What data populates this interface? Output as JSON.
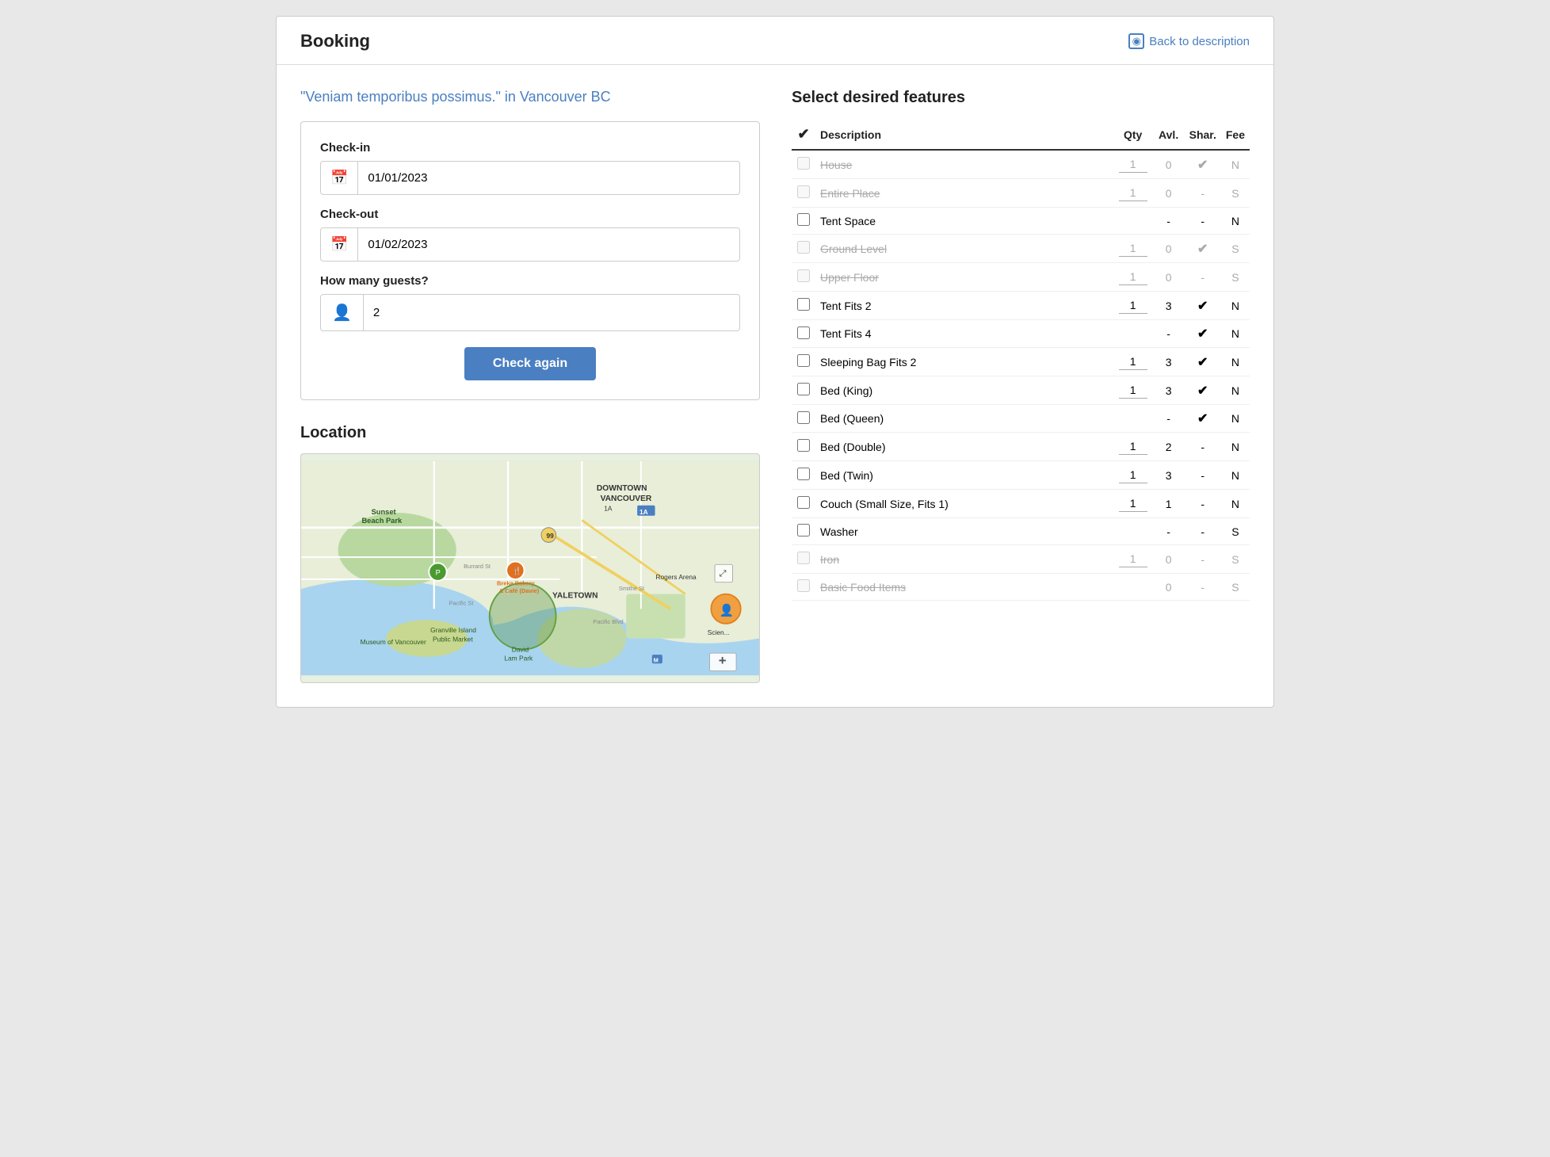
{
  "header": {
    "title": "Booking",
    "back_label": "Back to description",
    "back_icon": "◉"
  },
  "left": {
    "property_title": "\"Veniam temporibus possimus.\" in Vancouver BC",
    "checkin_label": "Check-in",
    "checkin_value": "01/01/2023",
    "checkin_placeholder": "01/01/2023",
    "checkout_label": "Check-out",
    "checkout_value": "01/02/2023",
    "checkout_placeholder": "01/02/2023",
    "guests_label": "How many guests?",
    "guests_value": "2",
    "check_again_label": "Check again",
    "location_label": "Location"
  },
  "features": {
    "title": "Select desired features",
    "columns": [
      "✔",
      "Description",
      "Qty",
      "Avl.",
      "Shar.",
      "Fee"
    ],
    "rows": [
      {
        "id": "house",
        "label": "House",
        "disabled": true,
        "strikethrough": true,
        "qty": "1",
        "avl": "0",
        "shar": "✔",
        "fee": "N",
        "checked": false
      },
      {
        "id": "entire-place",
        "label": "Entire Place",
        "disabled": true,
        "strikethrough": true,
        "qty": "1",
        "avl": "0",
        "shar": "",
        "fee": "S",
        "checked": false
      },
      {
        "id": "tent-space",
        "label": "Tent Space",
        "disabled": false,
        "strikethrough": false,
        "qty": "",
        "avl": "-",
        "shar": "",
        "fee": "N",
        "checked": false
      },
      {
        "id": "ground-level",
        "label": "Ground Level",
        "disabled": true,
        "strikethrough": true,
        "qty": "1",
        "avl": "0",
        "shar": "✔",
        "fee": "S",
        "checked": false
      },
      {
        "id": "upper-floor",
        "label": "Upper Floor",
        "disabled": true,
        "strikethrough": true,
        "qty": "1",
        "avl": "0",
        "shar": "",
        "fee": "S",
        "checked": false
      },
      {
        "id": "tent-fits-2",
        "label": "Tent Fits 2",
        "disabled": false,
        "strikethrough": false,
        "qty": "1",
        "avl": "3",
        "shar": "✔",
        "fee": "N",
        "checked": false
      },
      {
        "id": "tent-fits-4",
        "label": "Tent Fits 4",
        "disabled": false,
        "strikethrough": false,
        "qty": "",
        "avl": "-",
        "shar": "✔",
        "fee": "N",
        "checked": false
      },
      {
        "id": "sleeping-bag-fits-2",
        "label": "Sleeping Bag Fits 2",
        "disabled": false,
        "strikethrough": false,
        "qty": "1",
        "avl": "3",
        "shar": "✔",
        "fee": "N",
        "checked": false
      },
      {
        "id": "bed-king",
        "label": "Bed (King)",
        "disabled": false,
        "strikethrough": false,
        "qty": "1",
        "avl": "3",
        "shar": "✔",
        "fee": "N",
        "checked": false
      },
      {
        "id": "bed-queen",
        "label": "Bed (Queen)",
        "disabled": false,
        "strikethrough": false,
        "qty": "",
        "avl": "-",
        "shar": "✔",
        "fee": "N",
        "checked": false
      },
      {
        "id": "bed-double",
        "label": "Bed (Double)",
        "disabled": false,
        "strikethrough": false,
        "qty": "1",
        "avl": "2",
        "shar": "",
        "fee": "N",
        "checked": false
      },
      {
        "id": "bed-twin",
        "label": "Bed (Twin)",
        "disabled": false,
        "strikethrough": false,
        "qty": "1",
        "avl": "3",
        "shar": "",
        "fee": "N",
        "checked": false
      },
      {
        "id": "couch-small",
        "label": "Couch (Small Size, Fits 1)",
        "disabled": false,
        "strikethrough": false,
        "qty": "1",
        "avl": "1",
        "shar": "",
        "fee": "N",
        "checked": false
      },
      {
        "id": "washer",
        "label": "Washer",
        "disabled": false,
        "strikethrough": false,
        "qty": "",
        "avl": "-",
        "shar": "",
        "fee": "S",
        "checked": false
      },
      {
        "id": "iron",
        "label": "Iron",
        "disabled": true,
        "strikethrough": true,
        "qty": "1",
        "avl": "0",
        "shar": "",
        "fee": "S",
        "checked": false
      },
      {
        "id": "basic-food-items",
        "label": "Basic Food Items",
        "disabled": true,
        "strikethrough": true,
        "qty": "",
        "avl": "0",
        "shar": "",
        "fee": "S",
        "checked": false
      }
    ]
  }
}
